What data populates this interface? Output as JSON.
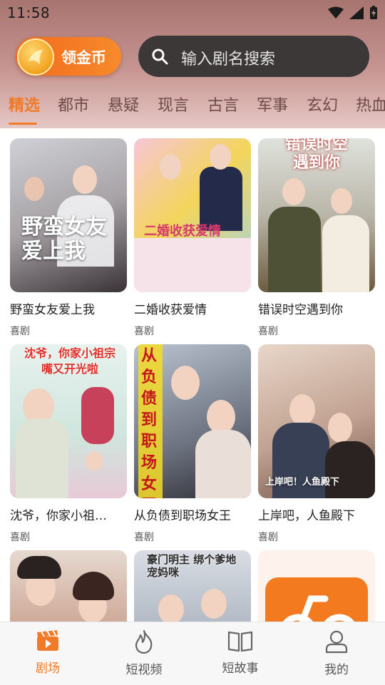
{
  "status_bar": {
    "time": "11:58"
  },
  "header": {
    "coin_button_label": "领金币",
    "search_placeholder": "输入剧名搜索",
    "tabs": [
      "精选",
      "都市",
      "悬疑",
      "现言",
      "古言",
      "军事",
      "玄幻",
      "热血"
    ],
    "active_tab": "精选"
  },
  "dramas": [
    {
      "title": "野蛮女友爱上我",
      "tag": "喜剧",
      "poster_text": "野蛮女友\n爱上我"
    },
    {
      "title": "二婚收获爱情",
      "tag": "喜剧",
      "poster_text": "二婚收获爱情"
    },
    {
      "title": "错误时空遇到你",
      "tag": "喜剧",
      "poster_text": "错误时空\n遇到你"
    },
    {
      "title": "沈爷，你家小祖…",
      "tag": "喜剧",
      "poster_text": "沈爷，你家小祖宗\n嘴又开光啦"
    },
    {
      "title": "从负债到职场女王",
      "tag": "喜剧",
      "poster_text": "从负债到职场女王"
    },
    {
      "title": "上岸吧，人鱼殿下",
      "tag": "喜剧",
      "poster_text": "上岸吧！人鱼殿下"
    },
    {
      "title": "",
      "tag": "",
      "poster_text": ""
    },
    {
      "title": "",
      "tag": "",
      "poster_text": "豪门明主 绑个爹地宠妈咪"
    },
    {
      "title": "",
      "tag": "",
      "poster_text": ""
    }
  ],
  "bottom_nav": {
    "items": [
      {
        "label": "剧场",
        "icon": "clapperboard-icon",
        "active": true
      },
      {
        "label": "短视频",
        "icon": "flame-icon",
        "active": false
      },
      {
        "label": "短故事",
        "icon": "book-icon",
        "active": false
      },
      {
        "label": "我的",
        "icon": "person-icon",
        "active": false
      }
    ]
  },
  "colors": {
    "accent": "#f07a28",
    "header": "#a87470"
  }
}
